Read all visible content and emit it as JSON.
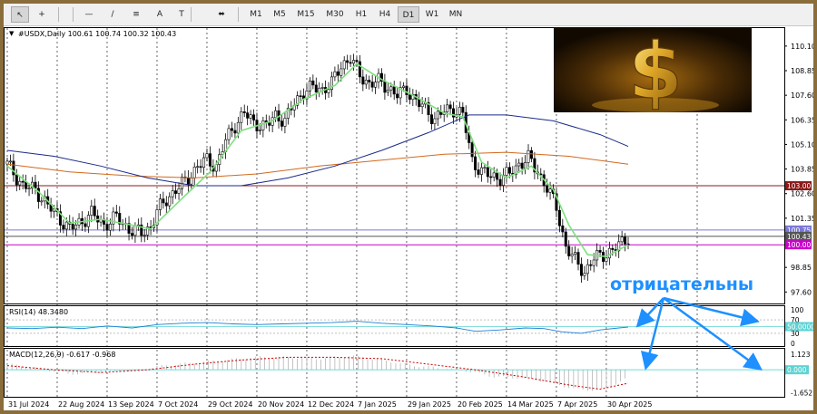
{
  "toolbar": {
    "tools": [
      {
        "name": "cursor-tool",
        "glyph": "↖"
      },
      {
        "name": "crosshair-tool",
        "glyph": "+"
      },
      {
        "name": "hline-tool",
        "glyph": "—"
      },
      {
        "name": "trendline-tool",
        "glyph": "/"
      },
      {
        "name": "fibo-tool",
        "glyph": "≡"
      },
      {
        "name": "text-tool",
        "glyph": "A"
      },
      {
        "name": "label-tool",
        "glyph": "T"
      },
      {
        "name": "shapes-tool",
        "glyph": "⬌"
      }
    ],
    "timeframes": [
      "M1",
      "M5",
      "M15",
      "M30",
      "H1",
      "H4",
      "D1",
      "W1",
      "MN"
    ],
    "active_timeframe": "D1"
  },
  "chart_data": {
    "type": "candlestick",
    "symbol_header": "#USDX,Daily  100.61 100.74 100.32 100.43",
    "x_labels": [
      "31 Jul 2024",
      "22 Aug 2024",
      "13 Sep 2024",
      "7 Oct 2024",
      "29 Oct 2024",
      "20 Nov 2024",
      "12 Dec 2024",
      "7 Jan 2025",
      "29 Jan 2025",
      "20 Feb 2025",
      "14 Mar 2025",
      "7 Apr 2025",
      "30 Apr 2025"
    ],
    "y_ticks": [
      "110.10",
      "108.85",
      "107.60",
      "106.35",
      "105.10",
      "103.85",
      "102.60",
      "101.35",
      "98.85",
      "97.60"
    ],
    "ylim": [
      97.2,
      110.6
    ],
    "price_levels": [
      {
        "value": 103.0,
        "label": "103.00",
        "color": "#8b1a1a"
      },
      {
        "value": 100.75,
        "label": "100.75",
        "color": "#7a7ad8"
      },
      {
        "value": 100.43,
        "label": "100.43",
        "color": "#555555"
      },
      {
        "value": 100.0,
        "label": "100.00",
        "color": "#cc00cc"
      }
    ],
    "close_path": [
      [
        0,
        104.1
      ],
      [
        5,
        103.0
      ],
      [
        9,
        102.8
      ],
      [
        13,
        102.0
      ],
      [
        17,
        101.3
      ],
      [
        20,
        100.8
      ],
      [
        24,
        101.2
      ],
      [
        27,
        101.6
      ],
      [
        31,
        101.0
      ],
      [
        35,
        101.4
      ],
      [
        39,
        100.8
      ],
      [
        43,
        100.6
      ],
      [
        46,
        100.9
      ],
      [
        48,
        101.7
      ],
      [
        51,
        102.3
      ],
      [
        54,
        102.8
      ],
      [
        57,
        103.2
      ],
      [
        61,
        104.0
      ],
      [
        64,
        104.3
      ],
      [
        67,
        104.0
      ],
      [
        70,
        105.3
      ],
      [
        73,
        106.1
      ],
      [
        76,
        106.7
      ],
      [
        79,
        106.2
      ],
      [
        83,
        106.0
      ],
      [
        86,
        106.6
      ],
      [
        89,
        106.3
      ],
      [
        92,
        107.2
      ],
      [
        95,
        107.8
      ],
      [
        98,
        108.0
      ],
      [
        101,
        107.9
      ],
      [
        104,
        108.2
      ],
      [
        107,
        109.1
      ],
      [
        110,
        109.5
      ],
      [
        113,
        108.6
      ],
      [
        116,
        108.2
      ],
      [
        119,
        108.3
      ],
      [
        122,
        108.0
      ],
      [
        125,
        107.6
      ],
      [
        128,
        107.9
      ],
      [
        131,
        107.3
      ],
      [
        134,
        106.9
      ],
      [
        137,
        106.4
      ],
      [
        140,
        106.8
      ],
      [
        143,
        106.9
      ],
      [
        146,
        106.6
      ],
      [
        149,
        104.3
      ],
      [
        152,
        103.7
      ],
      [
        155,
        103.5
      ],
      [
        158,
        103.4
      ],
      [
        161,
        103.6
      ],
      [
        164,
        104.1
      ],
      [
        167,
        104.4
      ],
      [
        170,
        103.7
      ],
      [
        173,
        102.9
      ],
      [
        176,
        101.9
      ],
      [
        179,
        99.9
      ],
      [
        182,
        99.2
      ],
      [
        185,
        98.6
      ],
      [
        188,
        99.3
      ],
      [
        191,
        99.5
      ],
      [
        194,
        99.7
      ],
      [
        197,
        100.1
      ],
      [
        199,
        100.43
      ]
    ],
    "ma_fast": [
      [
        0,
        104.0
      ],
      [
        10,
        102.7
      ],
      [
        20,
        101.1
      ],
      [
        30,
        101.3
      ],
      [
        40,
        101.0
      ],
      [
        46,
        100.8
      ],
      [
        55,
        102.2
      ],
      [
        65,
        103.7
      ],
      [
        75,
        105.8
      ],
      [
        85,
        106.3
      ],
      [
        95,
        107.4
      ],
      [
        105,
        108.1
      ],
      [
        112,
        109.2
      ],
      [
        120,
        108.4
      ],
      [
        130,
        107.6
      ],
      [
        140,
        106.7
      ],
      [
        146,
        106.5
      ],
      [
        152,
        104.2
      ],
      [
        160,
        103.4
      ],
      [
        168,
        104.0
      ],
      [
        175,
        102.8
      ],
      [
        180,
        101.0
      ],
      [
        186,
        99.5
      ],
      [
        192,
        99.4
      ],
      [
        199,
        100.0
      ]
    ],
    "ma_slow_orange": [
      [
        0,
        104.1
      ],
      [
        20,
        103.7
      ],
      [
        40,
        103.5
      ],
      [
        60,
        103.4
      ],
      [
        80,
        103.6
      ],
      [
        100,
        104.0
      ],
      [
        120,
        104.3
      ],
      [
        140,
        104.6
      ],
      [
        160,
        104.7
      ],
      [
        180,
        104.5
      ],
      [
        199,
        104.1
      ]
    ],
    "ma_slow_blue": [
      [
        0,
        104.8
      ],
      [
        15,
        104.5
      ],
      [
        30,
        104.0
      ],
      [
        45,
        103.4
      ],
      [
        60,
        103.0
      ],
      [
        75,
        103.0
      ],
      [
        90,
        103.4
      ],
      [
        105,
        104.0
      ],
      [
        120,
        104.8
      ],
      [
        135,
        105.7
      ],
      [
        148,
        106.6
      ],
      [
        160,
        106.6
      ],
      [
        175,
        106.3
      ],
      [
        190,
        105.6
      ],
      [
        199,
        105.0
      ]
    ],
    "rsi": {
      "label": "RSI(14) 48.3480",
      "ticks": [
        "100",
        "70",
        "50.0000",
        "30",
        "0"
      ],
      "values": [
        [
          0,
          46
        ],
        [
          8,
          44
        ],
        [
          16,
          48
        ],
        [
          24,
          44
        ],
        [
          32,
          52
        ],
        [
          40,
          46
        ],
        [
          48,
          56
        ],
        [
          56,
          60
        ],
        [
          64,
          62
        ],
        [
          72,
          58
        ],
        [
          80,
          56
        ],
        [
          88,
          58
        ],
        [
          96,
          60
        ],
        [
          104,
          62
        ],
        [
          112,
          66
        ],
        [
          120,
          60
        ],
        [
          128,
          56
        ],
        [
          136,
          52
        ],
        [
          144,
          46
        ],
        [
          150,
          36
        ],
        [
          158,
          40
        ],
        [
          166,
          46
        ],
        [
          172,
          44
        ],
        [
          178,
          34
        ],
        [
          184,
          30
        ],
        [
          190,
          40
        ],
        [
          196,
          46
        ],
        [
          199,
          48.3
        ]
      ]
    },
    "macd": {
      "label": "MACD(12,26,9) -0.617 -0.968",
      "ticks": [
        "1.123",
        "0.000",
        "-1.652"
      ],
      "histogram": [
        [
          0,
          0.4
        ],
        [
          10,
          0.1
        ],
        [
          20,
          -0.3
        ],
        [
          30,
          -0.2
        ],
        [
          40,
          -0.1
        ],
        [
          50,
          0.3
        ],
        [
          60,
          0.5
        ],
        [
          70,
          0.7
        ],
        [
          80,
          0.9
        ],
        [
          90,
          0.9
        ],
        [
          100,
          0.8
        ],
        [
          110,
          1.0
        ],
        [
          120,
          0.7
        ],
        [
          130,
          0.3
        ],
        [
          140,
          0.1
        ],
        [
          148,
          -0.1
        ],
        [
          156,
          -0.5
        ],
        [
          166,
          -0.6
        ],
        [
          174,
          -0.9
        ],
        [
          182,
          -1.4
        ],
        [
          190,
          -1.5
        ],
        [
          199,
          -0.6
        ]
      ],
      "signal": [
        [
          0,
          0.3
        ],
        [
          15,
          0.0
        ],
        [
          30,
          -0.2
        ],
        [
          45,
          0.0
        ],
        [
          60,
          0.4
        ],
        [
          75,
          0.7
        ],
        [
          90,
          0.9
        ],
        [
          105,
          0.9
        ],
        [
          120,
          0.8
        ],
        [
          135,
          0.4
        ],
        [
          150,
          0.0
        ],
        [
          165,
          -0.5
        ],
        [
          180,
          -1.1
        ],
        [
          190,
          -1.4
        ],
        [
          199,
          -0.97
        ]
      ]
    }
  },
  "annotation": {
    "text": "отрицательны",
    "color": "#1e90ff"
  }
}
